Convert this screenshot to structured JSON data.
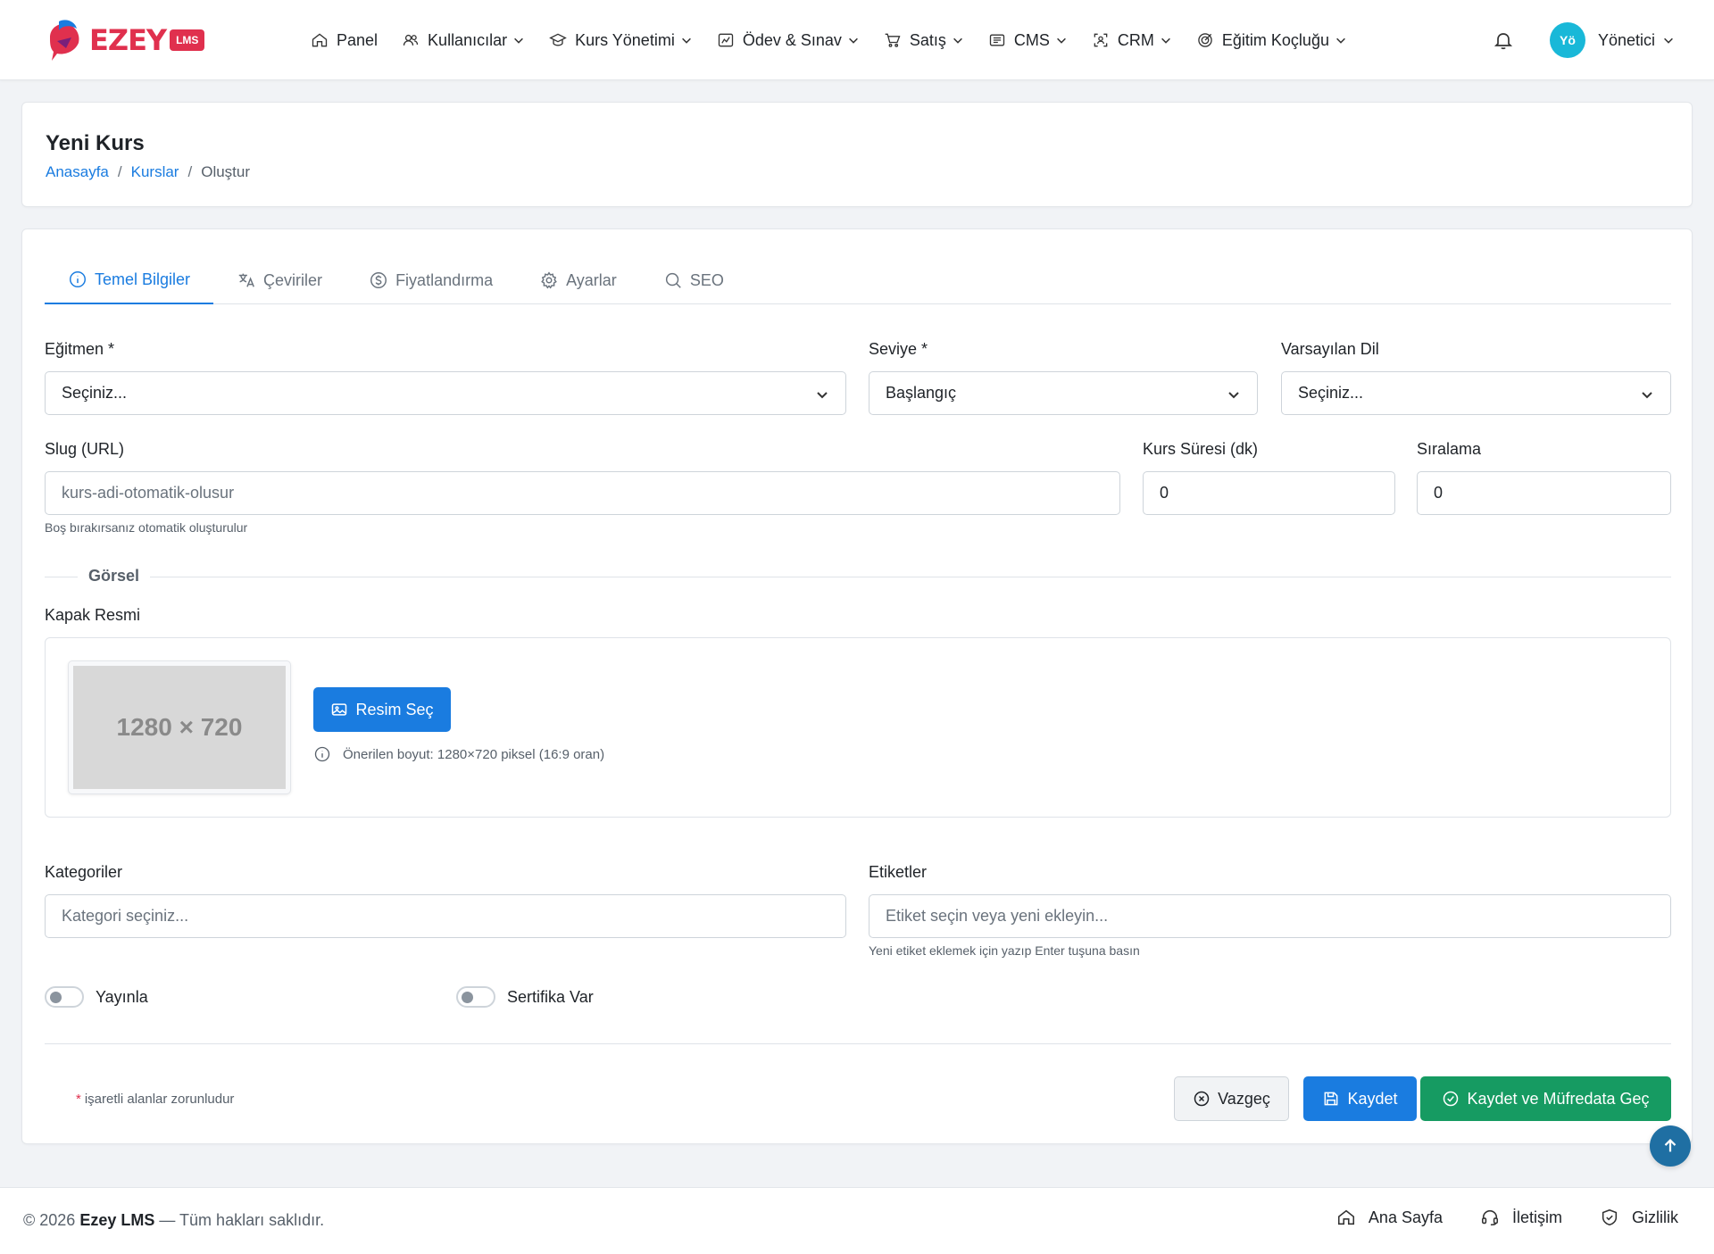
{
  "brand": {
    "name": "EZEY",
    "badge": "LMS",
    "accent": "#e0304e"
  },
  "nav": [
    {
      "label": "Panel",
      "icon": "home-icon",
      "dropdown": false
    },
    {
      "label": "Kullanıcılar",
      "icon": "users-icon",
      "dropdown": true
    },
    {
      "label": "Kurs Yönetimi",
      "icon": "graduation-cap-icon",
      "dropdown": true
    },
    {
      "label": "Ödev & Sınav",
      "icon": "chart-icon",
      "dropdown": true
    },
    {
      "label": "Satış",
      "icon": "cart-icon",
      "dropdown": true
    },
    {
      "label": "CMS",
      "icon": "layout-icon",
      "dropdown": true
    },
    {
      "label": "CRM",
      "icon": "scan-user-icon",
      "dropdown": true
    },
    {
      "label": "Eğitim Koçluğu",
      "icon": "target-icon",
      "dropdown": true
    }
  ],
  "user": {
    "initials": "Yö",
    "name": "Yönetici"
  },
  "page": {
    "title": "Yeni Kurs",
    "breadcrumb": [
      "Anasayfa",
      "Kurslar",
      "Oluştur"
    ]
  },
  "tabs": [
    {
      "label": "Temel Bilgiler",
      "icon": "info-icon",
      "active": true
    },
    {
      "label": "Çeviriler",
      "icon": "translate-icon",
      "active": false
    },
    {
      "label": "Fiyatlandırma",
      "icon": "dollar-icon",
      "active": false
    },
    {
      "label": "Ayarlar",
      "icon": "gear-icon",
      "active": false
    },
    {
      "label": "SEO",
      "icon": "search-icon",
      "active": false
    }
  ],
  "form": {
    "instructor": {
      "label": "Eğitmen *",
      "value": "Seçiniz..."
    },
    "level": {
      "label": "Seviye *",
      "value": "Başlangıç"
    },
    "default_language": {
      "label": "Varsayılan Dil",
      "value": "Seçiniz..."
    },
    "slug": {
      "label": "Slug (URL)",
      "placeholder": "kurs-adi-otomatik-olusur",
      "help": "Boş bırakırsanız otomatik oluşturulur"
    },
    "duration": {
      "label": "Kurs Süresi (dk)",
      "value": "0"
    },
    "order": {
      "label": "Sıralama",
      "value": "0"
    },
    "section_image": "Görsel",
    "cover": {
      "label": "Kapak Resmi",
      "placeholder_text": "1280 × 720",
      "button": "Resim Seç",
      "hint": "Önerilen boyut: 1280×720 piksel (16:9 oran)"
    },
    "categories": {
      "label": "Kategoriler",
      "placeholder": "Kategori seçiniz..."
    },
    "tags": {
      "label": "Etiketler",
      "placeholder": "Etiket seçin veya yeni ekleyin...",
      "help": "Yeni etiket eklemek için yazıp Enter tuşuna basın"
    },
    "publish": {
      "label": "Yayınla",
      "checked": false
    },
    "certificate": {
      "label": "Sertifika Var",
      "checked": false
    },
    "required_note": "işaretli alanlar zorunludur",
    "required_mark": "*",
    "buttons": {
      "cancel": "Vazgeç",
      "save": "Kaydet",
      "save_next": "Kaydet ve Müfredata Geç"
    }
  },
  "footer": {
    "copyright_prefix": "© 2026",
    "brand": "Ezey LMS",
    "copyright_suffix": "— Tüm hakları saklıdır.",
    "links": [
      {
        "label": "Ana Sayfa",
        "icon": "home-icon"
      },
      {
        "label": "İletişim",
        "icon": "headset-icon"
      },
      {
        "label": "Gizlilik",
        "icon": "shield-icon"
      }
    ]
  }
}
